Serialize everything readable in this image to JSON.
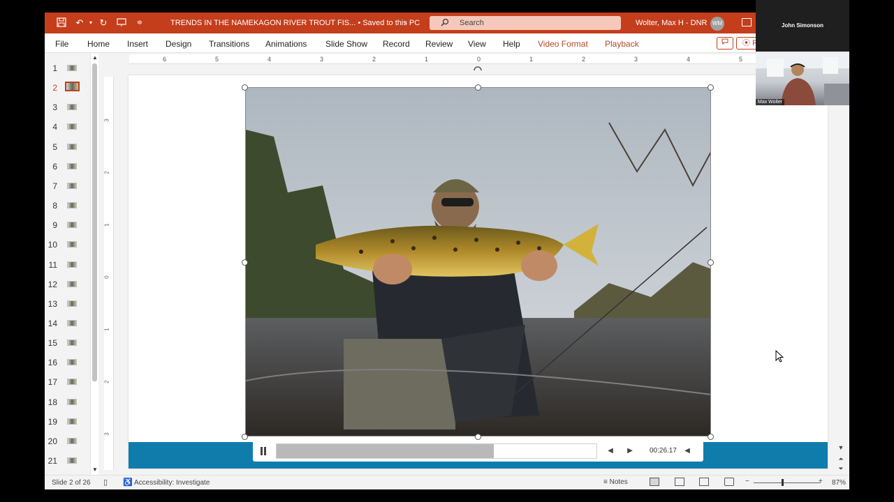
{
  "title_bar": {
    "doc_title": "TRENDS IN THE NAMEKAGON RIVER TROUT FIS... • Saved to this PC",
    "search_placeholder": "Search",
    "user_name": "Wolter, Max H - DNR",
    "user_initials": "WM"
  },
  "menu": {
    "tabs": [
      "File",
      "Home",
      "Insert",
      "Design",
      "Transitions",
      "Animations",
      "Slide Show",
      "Record",
      "Review",
      "View",
      "Help",
      "Video Format",
      "Playback"
    ],
    "record_label": "R"
  },
  "thumbnails": {
    "numbers": [
      "1",
      "2",
      "3",
      "4",
      "5",
      "6",
      "7",
      "8",
      "9",
      "10",
      "11",
      "12",
      "13",
      "14",
      "15",
      "16",
      "17",
      "18",
      "19",
      "20",
      "21"
    ],
    "selected": "2"
  },
  "ruler": {
    "horizontal": [
      "6",
      "5",
      "4",
      "3",
      "2",
      "1",
      "0",
      "1",
      "2",
      "3",
      "4",
      "5"
    ],
    "vertical": [
      "3",
      "2",
      "1",
      "0",
      "1",
      "2",
      "3"
    ]
  },
  "media": {
    "time": "00:26.17",
    "progress": 0.68
  },
  "status": {
    "slide_count": "Slide 2 of 26",
    "accessibility": "Accessibility: Investigate",
    "notes_label": "Notes",
    "zoom": "87%",
    "zoom_fraction": 0.42
  },
  "webcam": {
    "host_name": "John Simonson",
    "video_label": "Max Wolter"
  }
}
